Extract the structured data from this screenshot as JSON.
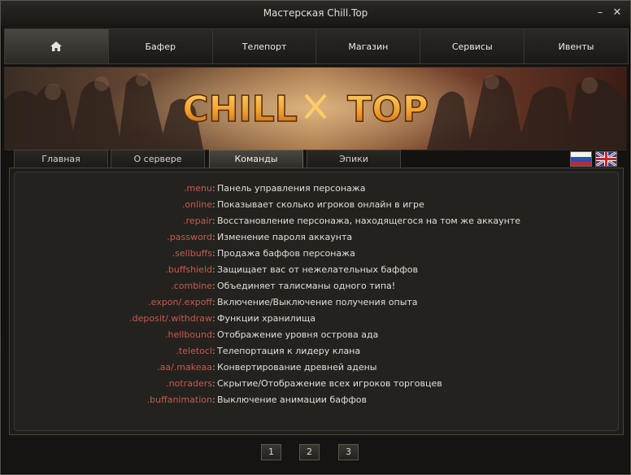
{
  "window": {
    "title": "Мастерская Chill.Top"
  },
  "nav": {
    "home_icon": "home-icon",
    "items": [
      "Бафер",
      "Телепорт",
      "Магазин",
      "Сервисы",
      "Ивенты"
    ]
  },
  "banner": {
    "logo_text": "CHILL TOP"
  },
  "tabs": [
    "Главная",
    "О сервере",
    "Команды",
    "Эпики"
  ],
  "active_tab": "Команды",
  "languages": [
    "ru-flag",
    "uk-flag"
  ],
  "commands": [
    {
      "cmd": ".menu",
      "desc": "Панель управления персонажа"
    },
    {
      "cmd": ".online",
      "desc": "Показывает сколько игроков онлайн в игре"
    },
    {
      "cmd": ".repair",
      "desc": "Восстановление персонажа, находящегося на том же аккаунте"
    },
    {
      "cmd": ".password",
      "desc": "Изменение пароля аккаунта"
    },
    {
      "cmd": ".sellbuffs",
      "desc": "Продажа баффов персонажа"
    },
    {
      "cmd": ".buffshield",
      "desc": "Защищает вас от нежелательных баффов"
    },
    {
      "cmd": ".combine",
      "desc": "Объединяет талисманы одного типа!"
    },
    {
      "cmd": ".expon/.expoff",
      "desc": "Включение/Выключение получения опыта"
    },
    {
      "cmd": ".deposit/.withdraw",
      "desc": "Функции хранилища"
    },
    {
      "cmd": ".hellbound",
      "desc": "Отображение уровня острова ада"
    },
    {
      "cmd": ".teletocl",
      "desc": "Телепортация к лидеру клана"
    },
    {
      "cmd": ".aa/.makeaa",
      "desc": "Конвертирование древней адены"
    },
    {
      "cmd": ".notraders",
      "desc": "Скрытие/Отображение всех игроков торговцев"
    },
    {
      "cmd": ".buffanimation",
      "desc": "Выключение анимации баффов"
    }
  ],
  "separator": ":",
  "pager": [
    "1",
    "2",
    "3"
  ],
  "colors": {
    "command": "#c85a4d",
    "logo": "#f0a030"
  }
}
